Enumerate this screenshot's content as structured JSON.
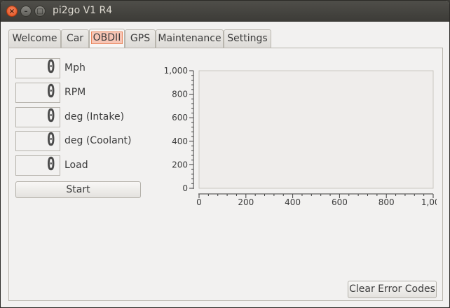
{
  "window": {
    "title": "pi2go V1 R4",
    "close_glyph": "×",
    "minimize_glyph": "–",
    "maximize_glyph": "□"
  },
  "tabs": [
    {
      "label": "Welcome"
    },
    {
      "label": "Car"
    },
    {
      "label": "OBDII",
      "active": true
    },
    {
      "label": "GPS"
    },
    {
      "label": "Maintenance"
    },
    {
      "label": "Settings"
    }
  ],
  "gauges": [
    {
      "value": "0",
      "label": "Mph"
    },
    {
      "value": "0",
      "label": "RPM"
    },
    {
      "value": "0",
      "label": "deg (Intake)"
    },
    {
      "value": "0",
      "label": "deg (Coolant)"
    },
    {
      "value": "0",
      "label": "Load"
    }
  ],
  "start_button": "Start",
  "clear_button": "Clear Error Codes",
  "chart_data": {
    "type": "line",
    "series": [],
    "xlim": [
      0,
      1000
    ],
    "ylim": [
      0,
      1000
    ],
    "xticks": [
      "0",
      "200",
      "400",
      "600",
      "800",
      "1,000"
    ],
    "yticks": [
      "0",
      "200",
      "400",
      "600",
      "800",
      "1,000"
    ],
    "grid": false
  },
  "colors": {
    "active_tab_highlight": "#f7c6b6",
    "active_tab_border": "#e9855b",
    "close_button": "#df4a16"
  }
}
